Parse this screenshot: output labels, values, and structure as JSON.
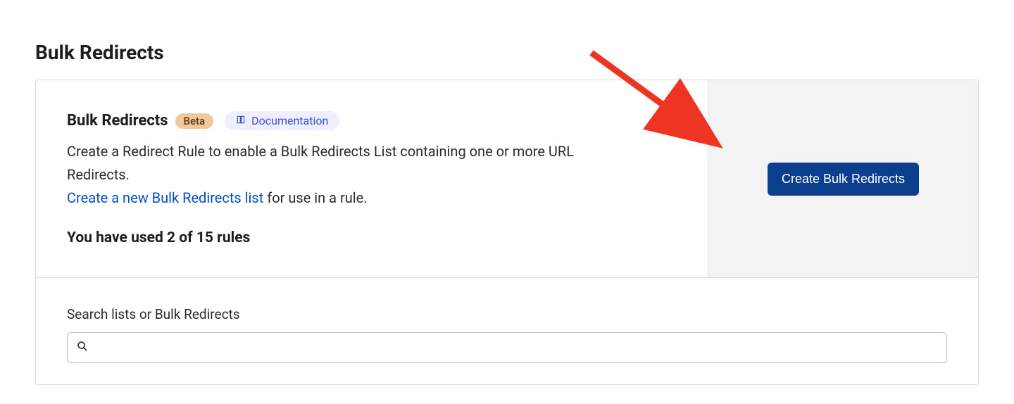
{
  "page": {
    "title": "Bulk Redirects"
  },
  "header": {
    "title": "Bulk Redirects",
    "badge": "Beta",
    "documentation_label": "Documentation"
  },
  "description": {
    "text": "Create a Redirect Rule to enable a Bulk Redirects List containing one or more URL Redirects.",
    "link_text": "Create a new Bulk Redirects list",
    "after_link": " for use in a rule."
  },
  "usage": {
    "text": "You have used 2 of 15 rules"
  },
  "action": {
    "create_label": "Create Bulk Redirects"
  },
  "search": {
    "label": "Search lists or Bulk Redirects",
    "value": ""
  },
  "colors": {
    "accent": "#0b3e8d",
    "link": "#0051c3",
    "doc_chip_bg": "#eef0ff",
    "doc_chip_fg": "#3b50d6",
    "beta_bg": "#f2c89a",
    "annotation": "#ee3524"
  }
}
